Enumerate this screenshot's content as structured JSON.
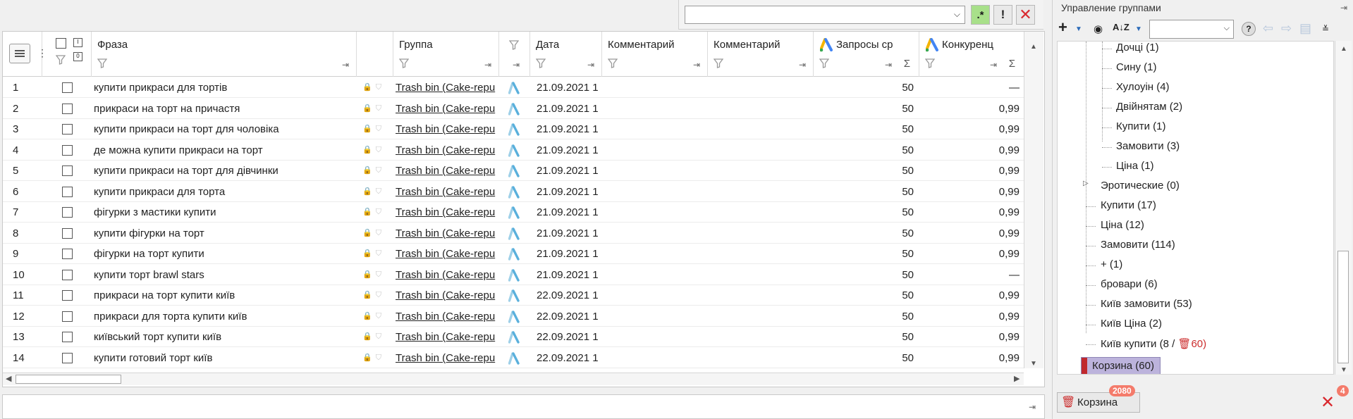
{
  "topbar": {
    "filter_value": "",
    "regex_label": ".*",
    "exclaim_label": "!",
    "close_label": "✕"
  },
  "grid": {
    "columns": {
      "phrase": "Фраза",
      "group": "Группа",
      "date": "Дата",
      "comment1": "Комментарий",
      "comment2": "Комментарий",
      "requests": "Запросы ср",
      "competition": "Конкуренц"
    },
    "rows": [
      {
        "n": "1",
        "phrase": "купити прикраси для тортів",
        "group": "Trash bin (Cake-repu",
        "date": "21.09.2021 1",
        "req": "50",
        "comp": "—"
      },
      {
        "n": "2",
        "phrase": "прикраси на торт на причастя",
        "group": "Trash bin (Cake-repu",
        "date": "21.09.2021 1",
        "req": "50",
        "comp": "0,99"
      },
      {
        "n": "3",
        "phrase": "купити прикраси на торт для чоловіка",
        "group": "Trash bin (Cake-repu",
        "date": "21.09.2021 1",
        "req": "50",
        "comp": "0,99"
      },
      {
        "n": "4",
        "phrase": "де можна купити прикраси на торт",
        "group": "Trash bin (Cake-repu",
        "date": "21.09.2021 1",
        "req": "50",
        "comp": "0,99"
      },
      {
        "n": "5",
        "phrase": "купити прикраси на торт для дівчинки",
        "group": "Trash bin (Cake-repu",
        "date": "21.09.2021 1",
        "req": "50",
        "comp": "0,99"
      },
      {
        "n": "6",
        "phrase": "купити прикраси для торта",
        "group": "Trash bin (Cake-repu",
        "date": "21.09.2021 1",
        "req": "50",
        "comp": "0,99"
      },
      {
        "n": "7",
        "phrase": "фігурки з мастики купити",
        "group": "Trash bin (Cake-repu",
        "date": "21.09.2021 1",
        "req": "50",
        "comp": "0,99"
      },
      {
        "n": "8",
        "phrase": "купити фігурки на торт",
        "group": "Trash bin (Cake-repu",
        "date": "21.09.2021 1",
        "req": "50",
        "comp": "0,99"
      },
      {
        "n": "9",
        "phrase": "фігурки на торт купити",
        "group": "Trash bin (Cake-repu",
        "date": "21.09.2021 1",
        "req": "50",
        "comp": "0,99"
      },
      {
        "n": "10",
        "phrase": "купити торт brawl stars",
        "group": "Trash bin (Cake-repu",
        "date": "21.09.2021 1",
        "req": "50",
        "comp": "—"
      },
      {
        "n": "11",
        "phrase": "прикраси на торт купити київ",
        "group": "Trash bin (Cake-repu",
        "date": "22.09.2021 1",
        "req": "50",
        "comp": "0,99"
      },
      {
        "n": "12",
        "phrase": "прикраси для торта купити київ",
        "group": "Trash bin (Cake-repu",
        "date": "22.09.2021 1",
        "req": "50",
        "comp": "0,99"
      },
      {
        "n": "13",
        "phrase": "київський торт купити київ",
        "group": "Trash bin (Cake-repu",
        "date": "22.09.2021 1",
        "req": "50",
        "comp": "0,99"
      },
      {
        "n": "14",
        "phrase": "купити готовий торт київ",
        "group": "Trash bin (Cake-repu",
        "date": "22.09.2021 1",
        "req": "50",
        "comp": "0,99"
      }
    ]
  },
  "groups_panel": {
    "title": "Управление группами",
    "tree": {
      "n1": "Дочці (1)",
      "n2": "Сину (1)",
      "n3": "Хулоуін (4)",
      "n4": "Двійнятам (2)",
      "n5": "Купити (1)",
      "n6": "Замовити (3)",
      "n7": "Ціна (1)",
      "n8": "Эротические (0)",
      "n9": "Купити (17)",
      "n10": "Ціна (12)",
      "n11": "Замовити (114)",
      "n12": "+ (1)",
      "n13": "бровари (6)",
      "n14": "Київ замовити (53)",
      "n15": "Київ Ціна (2)",
      "n16_pre": "Київ купити (8 /",
      "n16_trash": "60)",
      "selected": "Корзина (60)"
    },
    "basket_button": "Корзина",
    "basket_badge": "2080",
    "close_badge": "4"
  },
  "colors": {
    "accent_red": "#d9282e",
    "regex_green": "#a8e08a",
    "selection": "#bcb3dc"
  }
}
